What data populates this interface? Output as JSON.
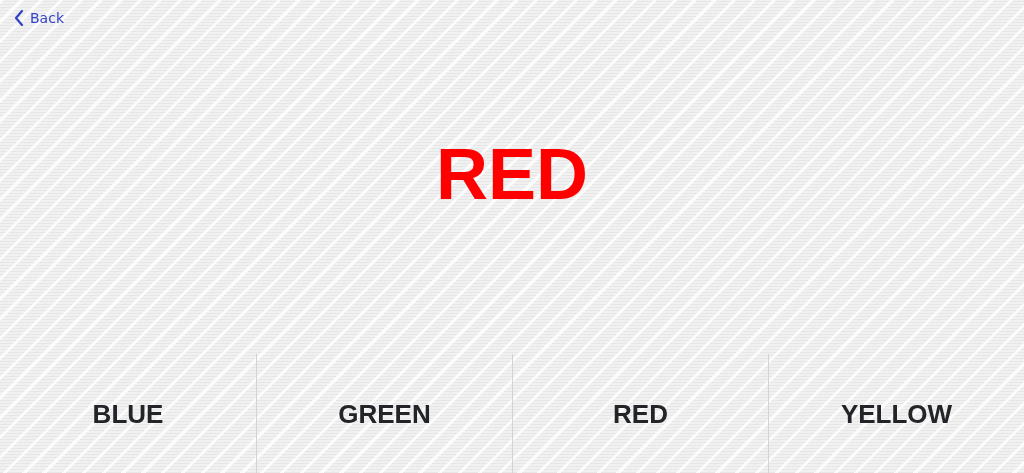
{
  "nav": {
    "back": "Back"
  },
  "prompt": {
    "word": "RED",
    "color": "#ff0000"
  },
  "answers": [
    {
      "label": "BLUE"
    },
    {
      "label": "GREEN"
    },
    {
      "label": "RED"
    },
    {
      "label": "YELLOW"
    }
  ]
}
